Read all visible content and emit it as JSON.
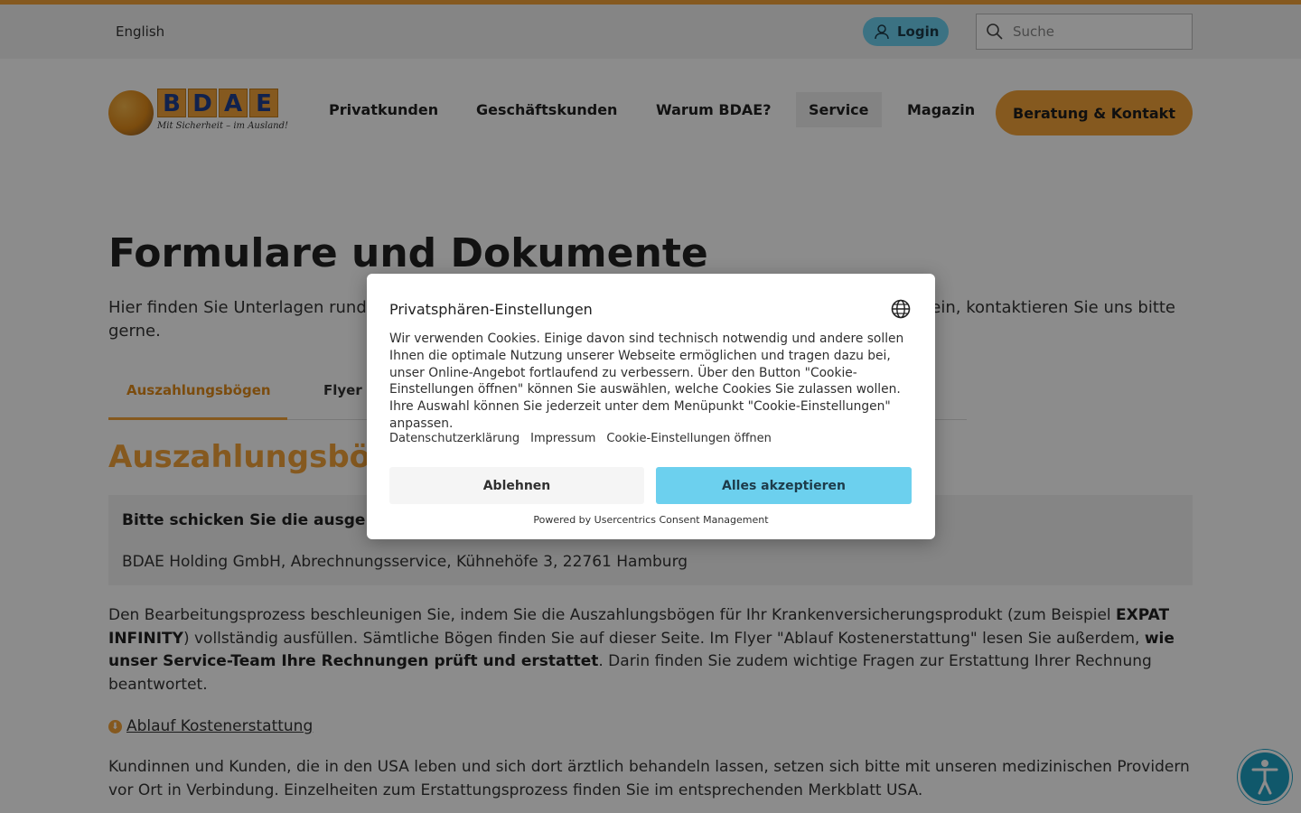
{
  "utility": {
    "language": "English",
    "login_label": "Login",
    "search_placeholder": "Suche"
  },
  "logo": {
    "letters": [
      "B",
      "D",
      "A",
      "E"
    ],
    "slogan": "Mit Sicherheit – im Ausland!"
  },
  "nav": {
    "items": [
      "Privatkunden",
      "Geschäftskunden",
      "Warum BDAE?",
      "Service",
      "Magazin"
    ],
    "active": "Service",
    "cta_label": "Beratung & Kontakt"
  },
  "page": {
    "title": "Formulare und Dokumente",
    "intro_start": "Hier finden Sie Unterlagen rund u",
    "intro_end": "sein, kontaktieren Sie uns bitte gerne."
  },
  "tabs": {
    "items": [
      "Auszahlungsbögen",
      "Flyer"
    ],
    "active": "Auszahlungsbögen"
  },
  "section": {
    "title": "Auszahlungsbö",
    "info_heading": "Bitte schicken Sie die ausge",
    "info_address": "BDAE Holding GmbH, Abrechnungsservice, Kühnehöfe 3, 22761 Hamburg",
    "paragraph1_a": "Den Bearbeitungsprozess beschleunigen Sie, indem Sie die Auszahlungsbögen für Ihr Krankenversicherungsprodukt (zum Beispiel ",
    "paragraph1_b": "EXPAT INFINITY",
    "paragraph1_c": ") vollständig ausfüllen. Sämtliche Bögen finden Sie auf dieser Seite. Im Flyer \"Ablauf Kostenerstattung\" lesen Sie außerdem, ",
    "paragraph1_d": "wie unser Service-Team Ihre Rechnungen prüft und erstattet",
    "paragraph1_e": ". Darin finden Sie zudem wichtige Fragen zur Erstattung Ihrer Rechnung beantwortet.",
    "download_link": "Ablauf Kostenerstattung",
    "paragraph2": "Kundinnen und Kunden, die in den USA leben und sich dort ärztlich behandeln lassen, setzen sich bitte mit unseren medizinischen Providern vor Ort in Verbindung. Einzelheiten zum Erstattungsprozess finden Sie im entsprechenden Merkblatt USA."
  },
  "consent": {
    "title": "Privatsphären-Einstellungen",
    "text": "Wir verwenden Cookies. Einige davon sind technisch notwendig und andere sollen Ihnen die optimale Nutzung unserer Webseite ermöglichen und tragen dazu bei, unser Online-Angebot fortlaufend zu verbessern. Über den Button \"Cookie-Einstellungen öffnen\" können Sie auswählen, welche Cookies Sie zulassen wollen. Ihre Auswahl können Sie jederzeit unter dem Menüpunkt \"Cookie-Einstellungen\" anpassen.",
    "links": [
      "Datenschutzerklärung",
      "Impressum",
      "Cookie-Einstellungen öffnen"
    ],
    "decline_label": "Ablehnen",
    "accept_label": "Alles akzeptieren",
    "powered_by": "Powered by Usercentrics Consent Management"
  },
  "colors": {
    "brand_orange": "#f2a23a",
    "accent_cyan": "#6cd0ee",
    "accessibility_blue": "#1ea0c4"
  }
}
